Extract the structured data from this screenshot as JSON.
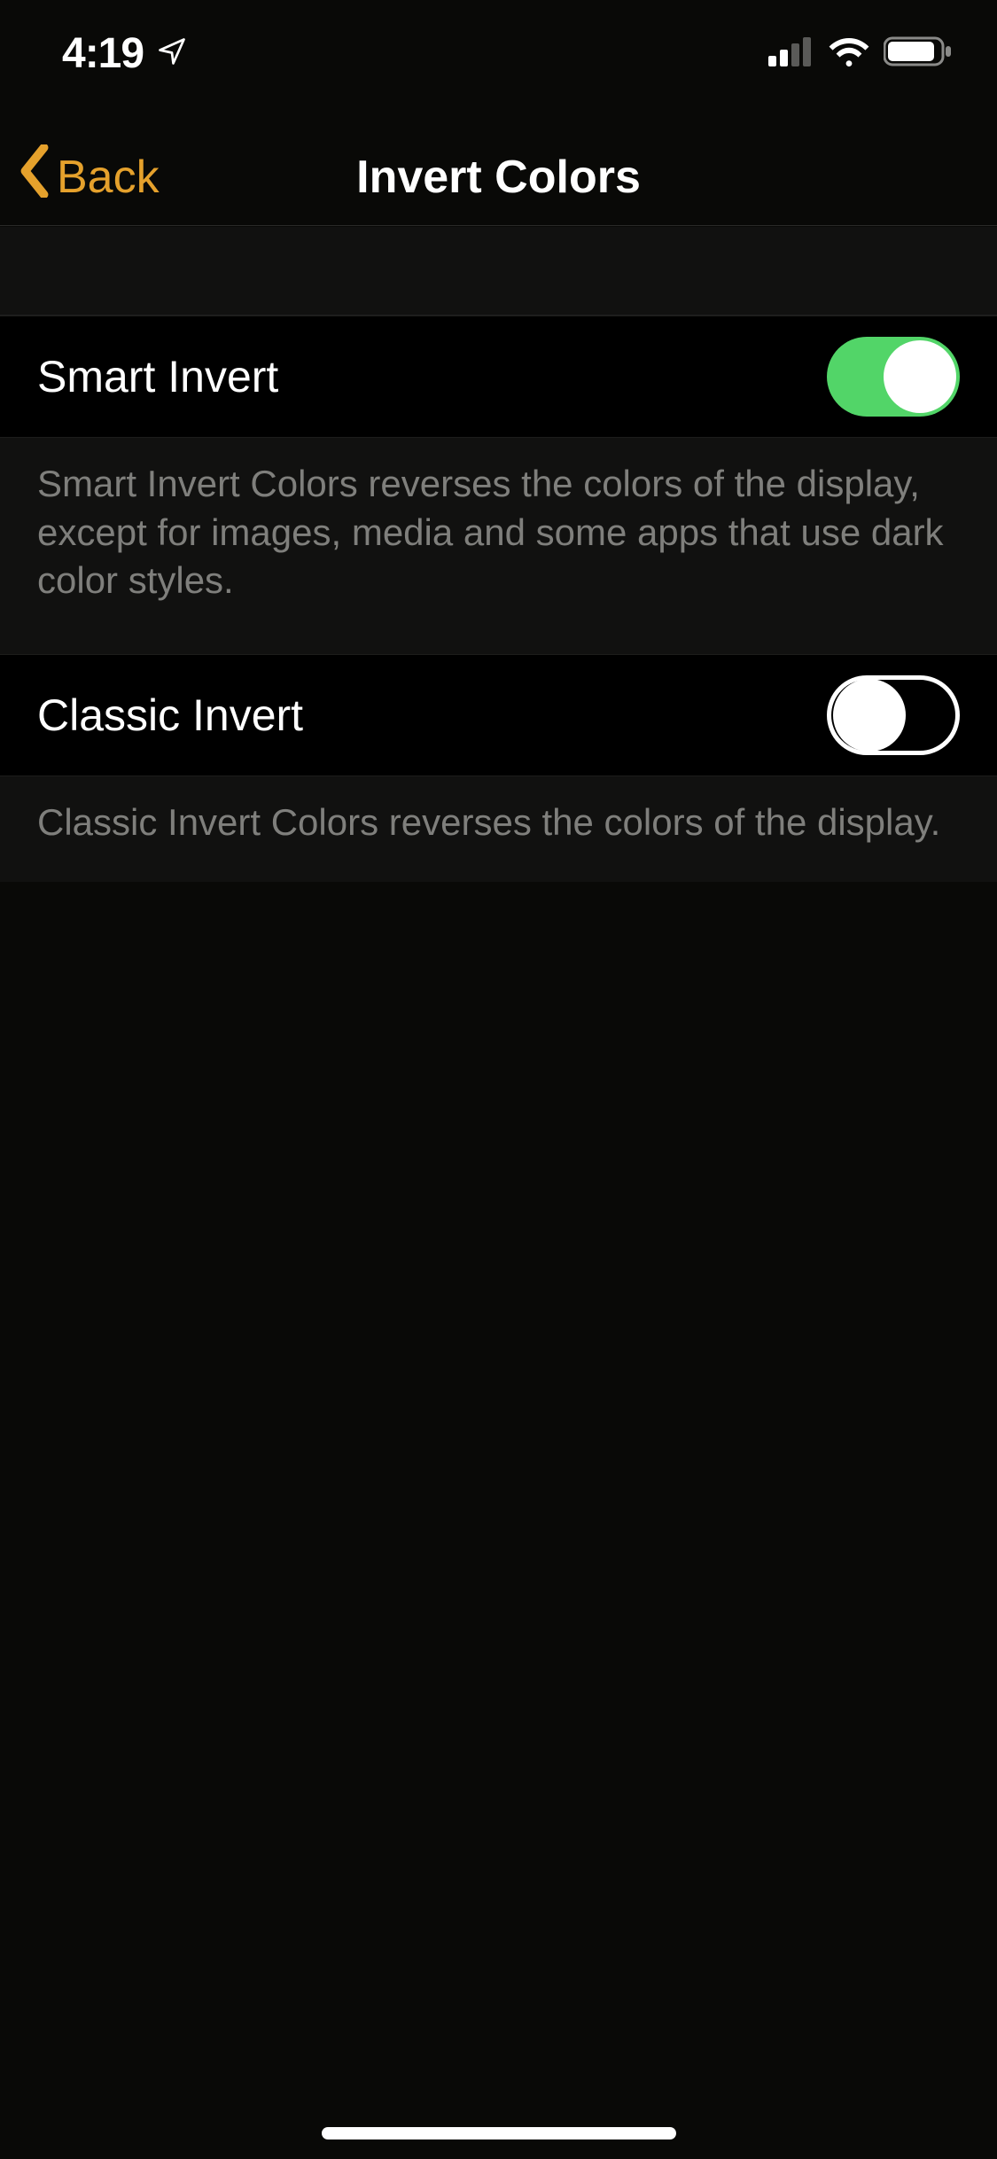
{
  "status": {
    "time": "4:19"
  },
  "nav": {
    "back_label": "Back",
    "title": "Invert Colors"
  },
  "settings": {
    "smart_invert": {
      "label": "Smart Invert",
      "enabled": true,
      "footer": "Smart Invert Colors reverses the colors of the display, except for images, media and some apps that use dark color styles."
    },
    "classic_invert": {
      "label": "Classic Invert",
      "enabled": false,
      "footer": "Classic Invert Colors reverses the colors of the display."
    }
  }
}
